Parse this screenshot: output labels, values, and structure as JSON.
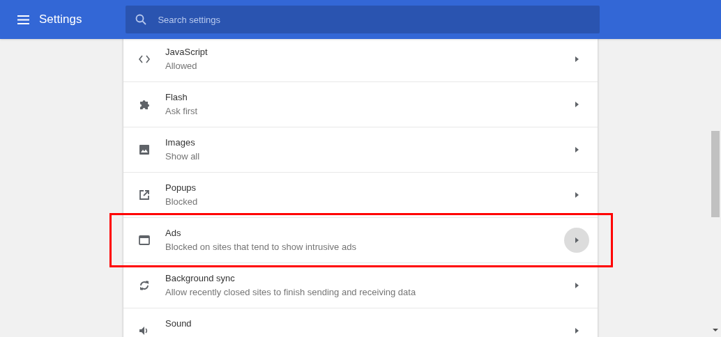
{
  "header": {
    "title": "Settings",
    "search": {
      "placeholder": "Search settings"
    }
  },
  "rows": [
    {
      "title": "JavaScript",
      "subtitle": "Allowed",
      "hovered": false,
      "highlighted": false
    },
    {
      "title": "Flash",
      "subtitle": "Ask first",
      "hovered": false,
      "highlighted": false
    },
    {
      "title": "Images",
      "subtitle": "Show all",
      "hovered": false,
      "highlighted": false
    },
    {
      "title": "Popups",
      "subtitle": "Blocked",
      "hovered": false,
      "highlighted": false
    },
    {
      "title": "Ads",
      "subtitle": "Blocked on sites that tend to show intrusive ads",
      "hovered": true,
      "highlighted": true
    },
    {
      "title": "Background sync",
      "subtitle": "Allow recently closed sites to finish sending and receiving data",
      "hovered": false,
      "highlighted": false
    },
    {
      "title": "Sound",
      "hovered": false,
      "highlighted": false
    }
  ]
}
